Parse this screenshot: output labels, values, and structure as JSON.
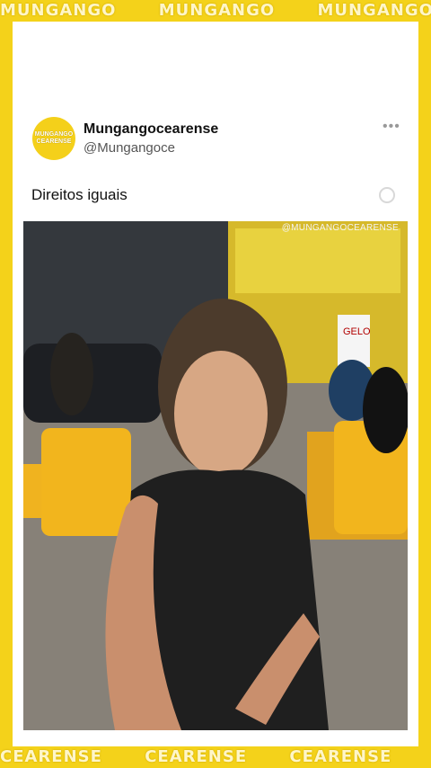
{
  "brand": {
    "top_banner_text": "MUNGANGO",
    "bottom_banner_text": "CEARENSE",
    "side_letters": "MC",
    "accent_color": "#F4D21A"
  },
  "tweet": {
    "avatar_text": "MUNGANGO CEARENSE",
    "display_name": "Mungangocearense",
    "handle": "@Mungangoce",
    "more_icon": "more-dots-icon",
    "text": "Direitos iguais"
  },
  "media": {
    "watermark": "@MUNGANGOCEARENSE",
    "sign_text_1": "GELO",
    "type": "video"
  }
}
